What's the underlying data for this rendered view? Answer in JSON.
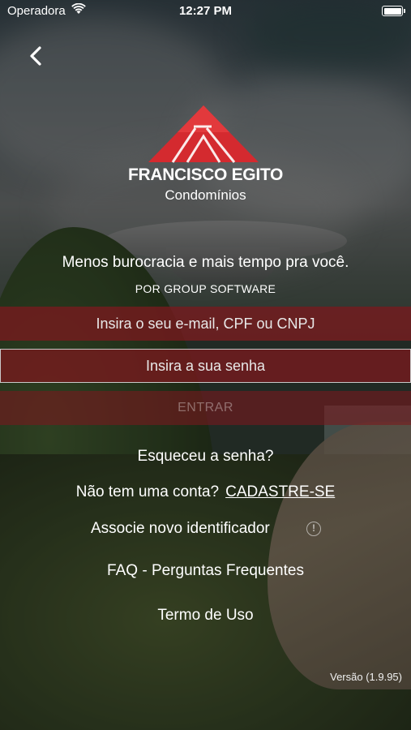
{
  "status_bar": {
    "carrier": "Operadora",
    "time": "12:27 PM",
    "battery_level": 1.0
  },
  "nav": {
    "back_icon": "chevron-left-icon"
  },
  "brand": {
    "name": "FRANCISCO EGITO",
    "subtitle": "Condomínios",
    "logo_color": "#d42a2f"
  },
  "tagline": "Menos burocracia e mais tempo pra você.",
  "byline": "POR GROUP SOFTWARE",
  "form": {
    "login_placeholder": "Insira o seu e-mail, CPF ou CNPJ",
    "password_placeholder": "Insira a sua senha",
    "submit_label": "ENTRAR",
    "field_color": "#78191e"
  },
  "links": {
    "forgot": "Esqueceu a senha?",
    "signup_prompt": "Não tem uma conta?",
    "signup_cta": "CADASTRE-SE",
    "associate": "Associe novo identificador",
    "associate_info_icon": "info-icon",
    "faq": "FAQ - Perguntas Frequentes",
    "terms": "Termo de Uso"
  },
  "version": "Versão (1.9.95)"
}
